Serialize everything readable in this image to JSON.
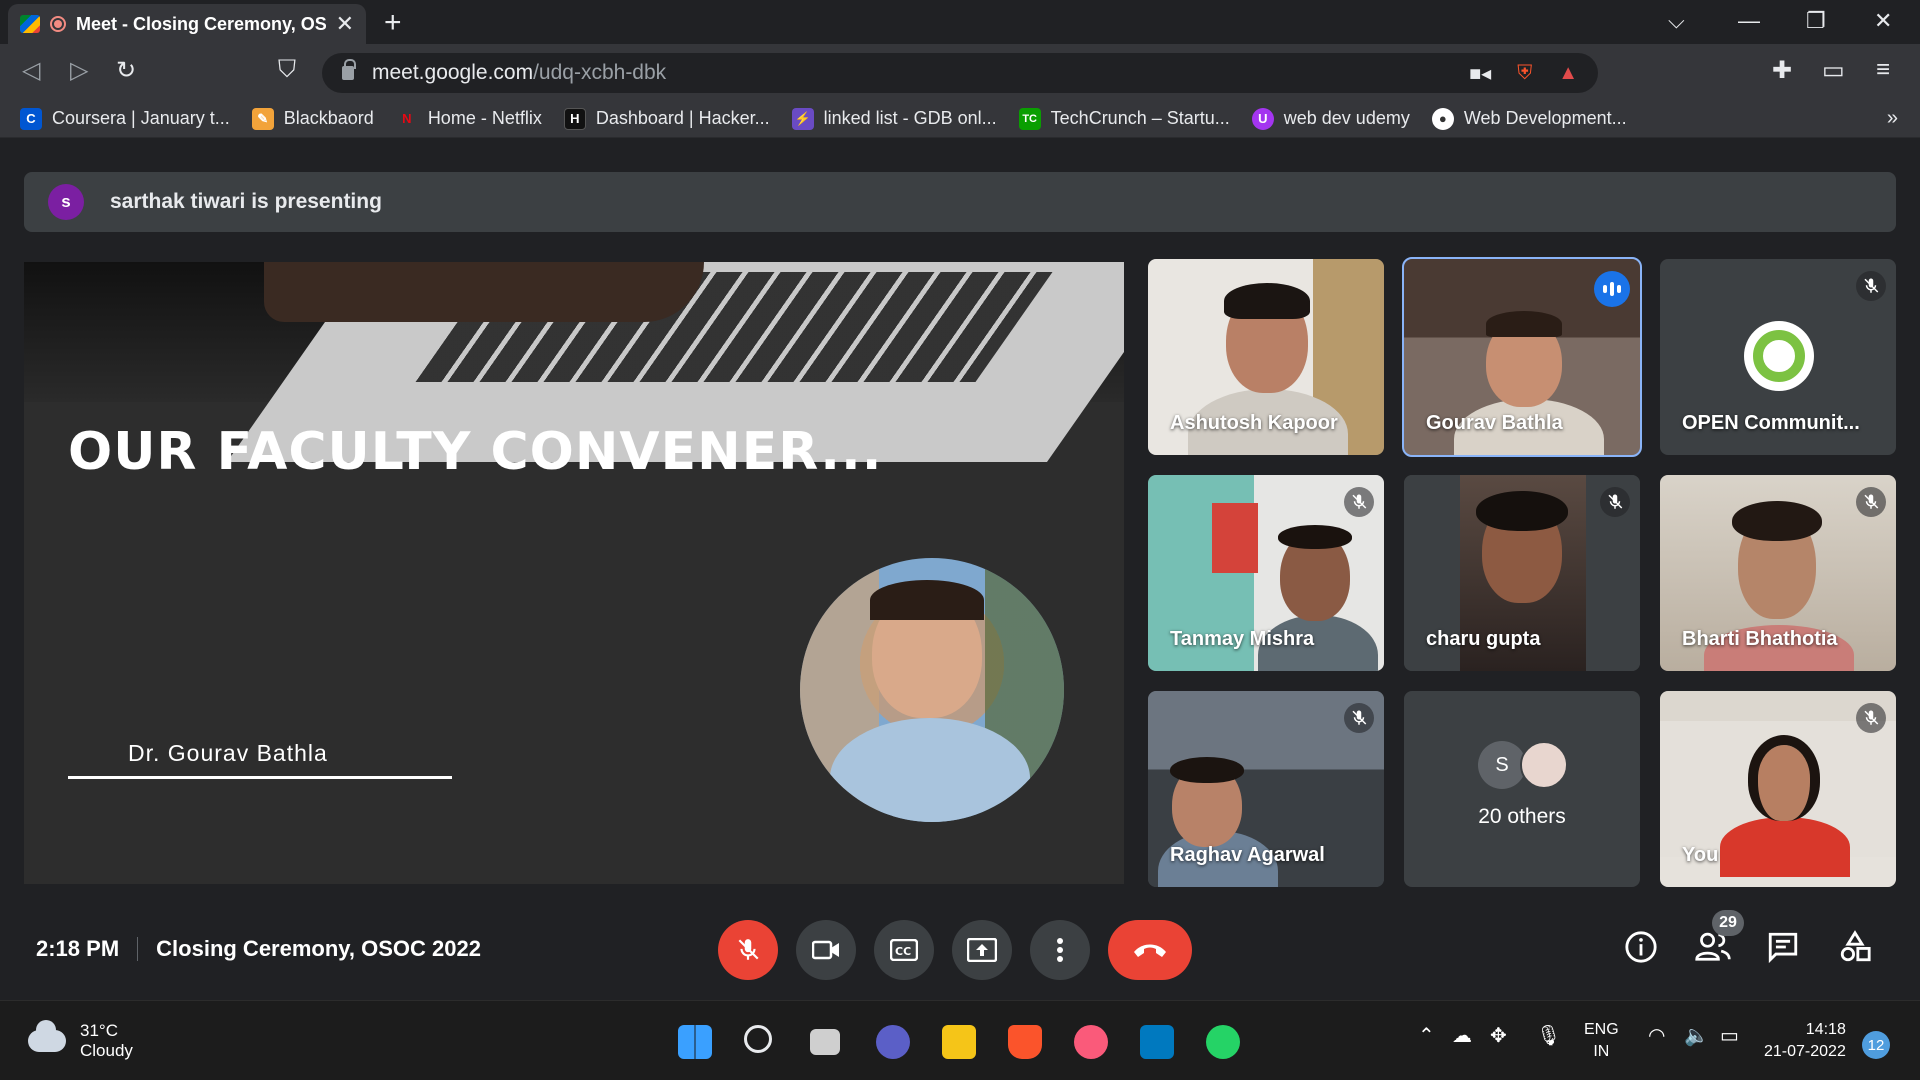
{
  "browser": {
    "tab_title": "Meet - Closing Ceremony, OSC",
    "url_domain": "meet.google.com",
    "url_path": "/udq-xcbh-dbk",
    "bookmarks": [
      {
        "label": "Coursera | January t...",
        "icon": "C",
        "color": "#0056d2"
      },
      {
        "label": "Blackbaord",
        "icon": "✎",
        "color": "#f2a33a"
      },
      {
        "label": "Home - Netflix",
        "icon": "N",
        "color": "#e50914"
      },
      {
        "label": "Dashboard | Hacker...",
        "icon": "H",
        "color": "#111111"
      },
      {
        "label": "linked list - GDB onl...",
        "icon": "⚡",
        "color": "#6a4bc4"
      },
      {
        "label": "TechCrunch – Startu...",
        "icon": "TC",
        "color": "#0a9e01"
      },
      {
        "label": "web dev udemy",
        "icon": "U",
        "color": "#a435f0"
      },
      {
        "label": "Web Development...",
        "icon": "●",
        "color": "#ffffff"
      }
    ],
    "more_bookmarks": "»"
  },
  "meet": {
    "presenter_initial": "s",
    "presenter_banner": "sarthak tiwari is presenting",
    "slide": {
      "heading": "OUR FACULTY CONVENER...",
      "name": "Dr. Gourav Bathla"
    },
    "participants": [
      {
        "name": "Ashutosh Kapoor"
      },
      {
        "name": "Gourav Bathla"
      },
      {
        "name": "OPEN Communit..."
      },
      {
        "name": "Tanmay Mishra"
      },
      {
        "name": "charu gupta"
      },
      {
        "name": "Bharti Bhathotia"
      },
      {
        "name": "Raghav Agarwal"
      },
      {
        "name": "You"
      }
    ],
    "others": {
      "avatar_initial": "S",
      "label": "20 others"
    },
    "bottom": {
      "time": "2:18 PM",
      "meeting_title": "Closing Ceremony, OSOC 2022",
      "people_count": "29"
    }
  },
  "taskbar": {
    "temperature": "31°C",
    "condition": "Cloudy",
    "lang_top": "ENG",
    "lang_bottom": "IN",
    "time": "14:18",
    "date": "21-07-2022",
    "notifications": "12"
  }
}
